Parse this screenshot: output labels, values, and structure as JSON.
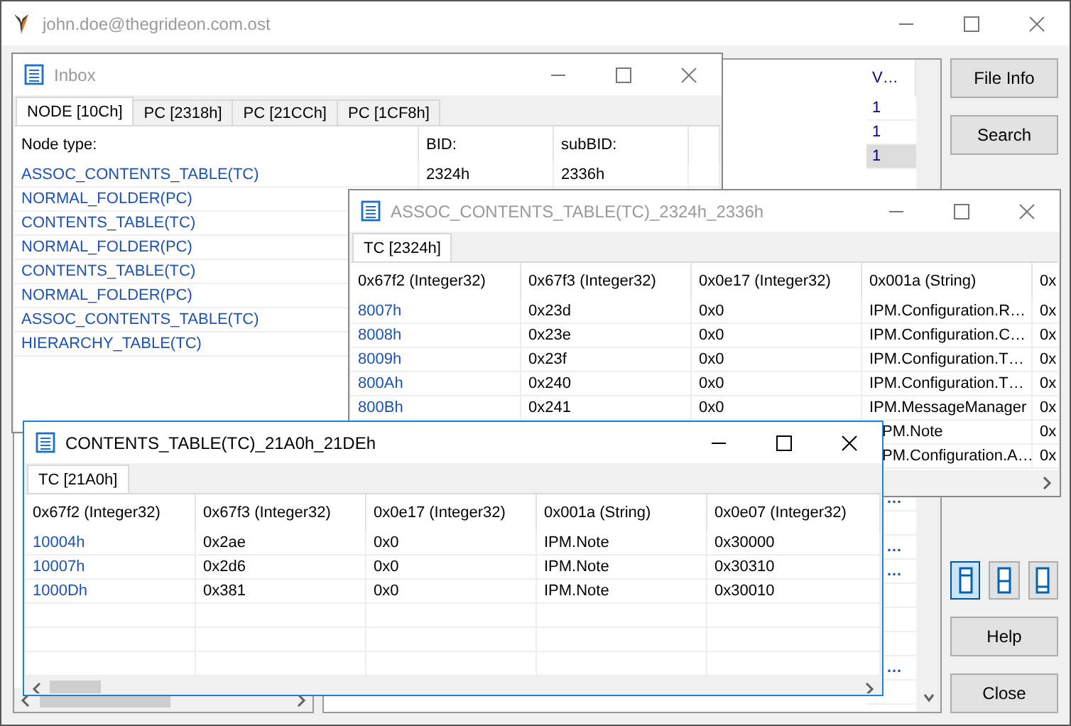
{
  "window": {
    "title": "john.doe@thegrideon.com.ost"
  },
  "list": {
    "columns": [
      "V…"
    ],
    "rows": [
      {
        "v": "1",
        "selected": false
      },
      {
        "v": "1",
        "selected": false
      },
      {
        "v": "1",
        "selected": true
      }
    ],
    "lower_rows": [
      {
        "kind": "text",
        "v": "…"
      },
      {
        "kind": "empty"
      },
      {
        "kind": "text",
        "v": "…"
      },
      {
        "kind": "text",
        "v": "…"
      },
      {
        "kind": "empty"
      },
      {
        "kind": "empty"
      },
      {
        "kind": "empty"
      },
      {
        "kind": "text",
        "v": "…"
      },
      {
        "kind": "empty"
      }
    ]
  },
  "buttons": [
    {
      "label": "File Info"
    },
    {
      "label": "Search"
    }
  ],
  "layout_buttons": [
    {
      "kind": "split-top",
      "selected": true
    },
    {
      "kind": "split-middle",
      "selected": false
    },
    {
      "kind": "split-bottom",
      "selected": false
    }
  ],
  "bottom_buttons": [
    {
      "label": "Help"
    },
    {
      "label": "Close"
    }
  ],
  "child_windows": [
    {
      "title": "Inbox",
      "active": false,
      "tabs": [
        {
          "label": "NODE [10Ch]",
          "selected": true
        },
        {
          "label": "PC [2318h]",
          "selected": false
        },
        {
          "label": "PC [21CCh]",
          "selected": false
        },
        {
          "label": "PC [1CF8h]",
          "selected": false
        }
      ],
      "columns": [
        "Node type:",
        "BID:",
        "subBID:"
      ],
      "rows": [
        {
          "cells": [
            "ASSOC_CONTENTS_TABLE(TC)",
            "2324h",
            "2336h"
          ]
        },
        {
          "cells": [
            "NORMAL_FOLDER(PC)"
          ]
        },
        {
          "cells": [
            "CONTENTS_TABLE(TC)"
          ]
        },
        {
          "cells": [
            "NORMAL_FOLDER(PC)"
          ]
        },
        {
          "cells": [
            "CONTENTS_TABLE(TC)"
          ]
        },
        {
          "cells": [
            "NORMAL_FOLDER(PC)"
          ]
        },
        {
          "cells": [
            "ASSOC_CONTENTS_TABLE(TC)"
          ]
        },
        {
          "cells": [
            "HIERARCHY_TABLE(TC)"
          ]
        }
      ]
    },
    {
      "title": "ASSOC_CONTENTS_TABLE(TC)_2324h_2336h",
      "active": false,
      "tabs": [
        {
          "label": "TC [2324h]",
          "selected": true
        }
      ],
      "columns": [
        "0x67f2 (Integer32)",
        "0x67f3 (Integer32)",
        "0x0e17 (Integer32)",
        "0x001a (String)",
        "0x"
      ],
      "rows": [
        {
          "cells": [
            "8007h",
            "0x23d",
            "0x0",
            "IPM.Configuration.R…",
            "0x"
          ]
        },
        {
          "cells": [
            "8008h",
            "0x23e",
            "0x0",
            "IPM.Configuration.C…",
            "0x"
          ]
        },
        {
          "cells": [
            "8009h",
            "0x23f",
            "0x0",
            "IPM.Configuration.T…",
            "0x"
          ]
        },
        {
          "cells": [
            "800Ah",
            "0x240",
            "0x0",
            "IPM.Configuration.T…",
            "0x"
          ]
        },
        {
          "cells": [
            "800Bh",
            "0x241",
            "0x0",
            "IPM.MessageManager",
            "0x"
          ]
        },
        {
          "cells": [
            null,
            null,
            null,
            "PM.Note",
            "0x"
          ]
        },
        {
          "cells": [
            null,
            null,
            null,
            "PM.Configuration.A…",
            "0x"
          ]
        }
      ]
    },
    {
      "title": "CONTENTS_TABLE(TC)_21A0h_21DEh",
      "active": true,
      "tabs": [
        {
          "label": "TC [21A0h]",
          "selected": true
        }
      ],
      "columns": [
        "0x67f2 (Integer32)",
        "0x67f3 (Integer32)",
        "0x0e17 (Integer32)",
        "0x001a (String)",
        "0x0e07 (Integer32)"
      ],
      "rows": [
        {
          "cells": [
            "10004h",
            "0x2ae",
            "0x0",
            "IPM.Note",
            "0x30000"
          ]
        },
        {
          "cells": [
            "10007h",
            "0x2d6",
            "0x0",
            "IPM.Note",
            "0x30310"
          ]
        },
        {
          "cells": [
            "1000Dh",
            "0x381",
            "0x0",
            "IPM.Note",
            "0x30010"
          ]
        }
      ]
    }
  ]
}
